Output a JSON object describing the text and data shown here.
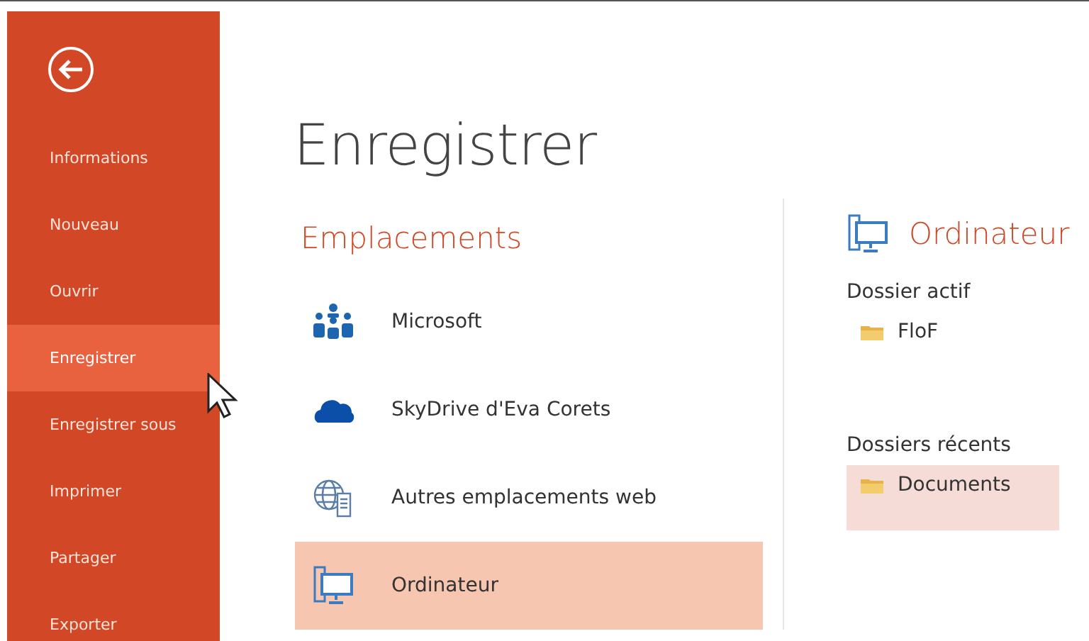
{
  "sidebar": {
    "items": [
      {
        "label": "Informations",
        "selected": false
      },
      {
        "label": "Nouveau",
        "selected": false
      },
      {
        "label": "Ouvrir",
        "selected": false
      },
      {
        "label": "Enregistrer",
        "selected": true
      },
      {
        "label": "Enregistrer sous",
        "selected": false
      },
      {
        "label": "Imprimer",
        "selected": false
      },
      {
        "label": "Partager",
        "selected": false
      },
      {
        "label": "Exporter",
        "selected": false
      }
    ]
  },
  "page_title": "Enregistrer",
  "locations": {
    "heading": "Emplacements",
    "items": [
      {
        "kind": "people",
        "label": "Microsoft",
        "selected": false
      },
      {
        "kind": "cloud",
        "label": "SkyDrive d'Eva Corets",
        "selected": false
      },
      {
        "kind": "globe",
        "label": "Autres emplacements web",
        "selected": false
      },
      {
        "kind": "computer",
        "label": "Ordinateur",
        "selected": true
      }
    ]
  },
  "detail": {
    "heading": "Ordinateur",
    "sections": [
      {
        "title": "Dossier actif",
        "folders": [
          {
            "name": "FloF",
            "selected": false
          }
        ]
      },
      {
        "title": "Dossiers récents",
        "folders": [
          {
            "name": "Documents",
            "selected": true
          }
        ]
      }
    ]
  }
}
